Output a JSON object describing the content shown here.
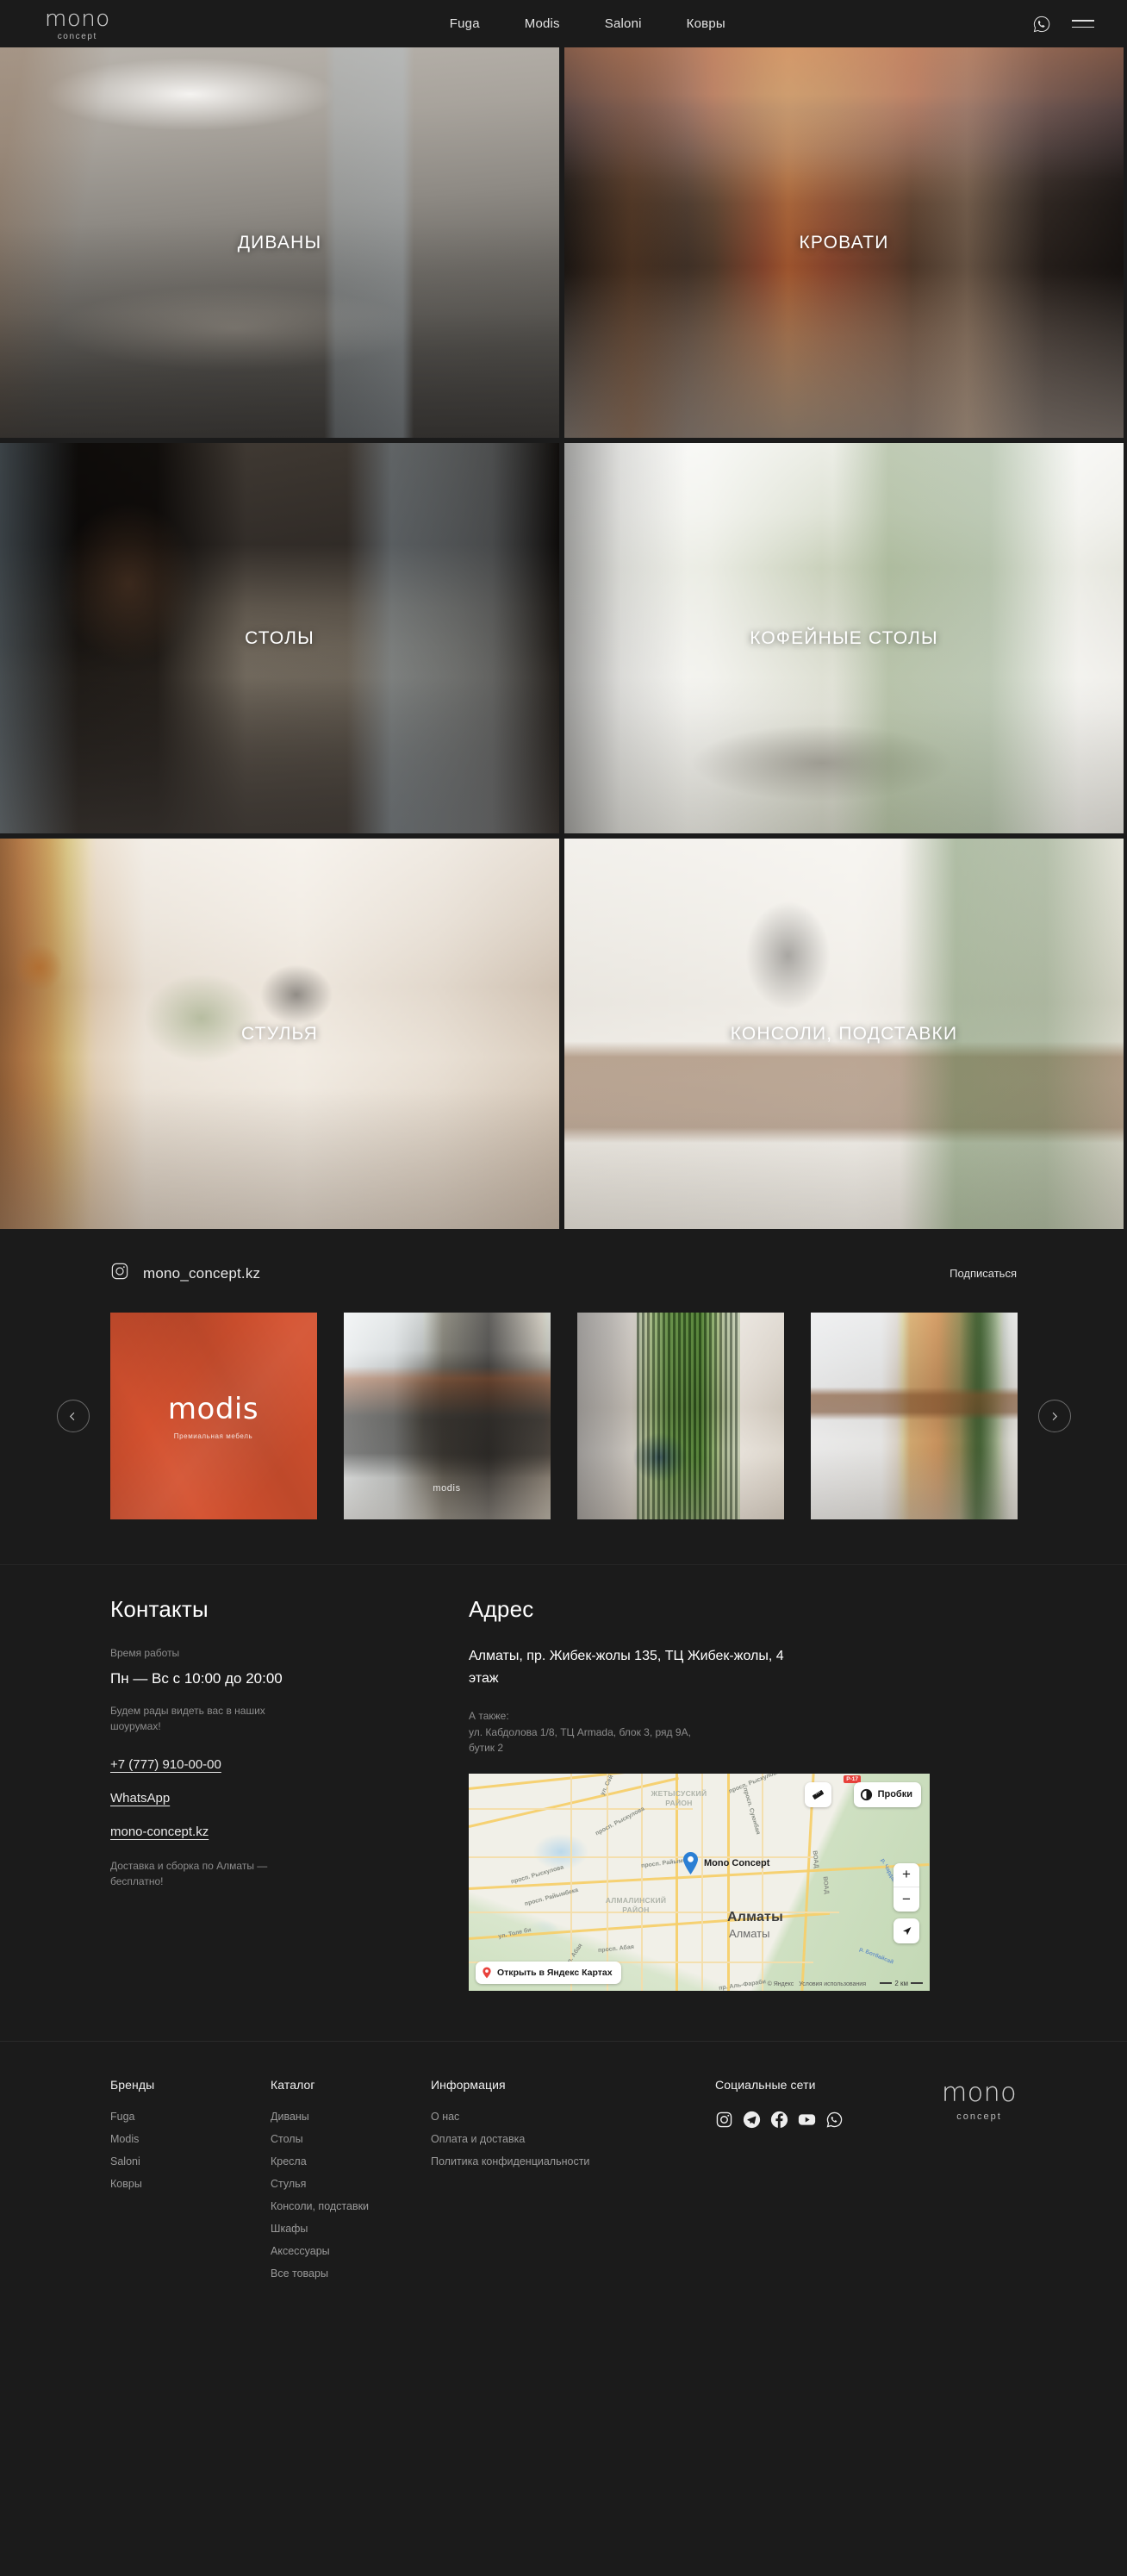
{
  "header": {
    "logo": {
      "main": "mono",
      "sub": "concept"
    },
    "nav": [
      {
        "label": "Fuga"
      },
      {
        "label": "Modis"
      },
      {
        "label": "Saloni"
      },
      {
        "label": "Ковры"
      }
    ],
    "whatsapp_icon": "whatsapp-icon",
    "menu_icon": "hamburger-menu-icon"
  },
  "categories": [
    {
      "label": "ДИВАНЫ"
    },
    {
      "label": "КРОВАТИ"
    },
    {
      "label": "СТОЛЫ"
    },
    {
      "label": "КОФЕЙНЫЕ СТОЛЫ"
    },
    {
      "label": "СТУЛЬЯ"
    },
    {
      "label": "КОНСОЛИ, ПОДСТАВКИ"
    }
  ],
  "instagram": {
    "handle": "mono_concept.kz",
    "subscribe_label": "Подписаться",
    "prev_label": "‹",
    "next_label": "›",
    "cards": [
      {
        "title": "modis",
        "subtitle": "Премиальная мебель",
        "tag": ""
      },
      {
        "title": "",
        "subtitle": "",
        "tag": "modis"
      },
      {
        "title": "",
        "subtitle": "",
        "tag": ""
      },
      {
        "title": "",
        "subtitle": "",
        "tag": ""
      }
    ]
  },
  "contacts": {
    "title": "Контакты",
    "hours_label": "Время работы",
    "hours_value": "Пн — Вс с 10:00 до 20:00",
    "welcome_note": "Будем рады видеть вас в наших шоурумах!",
    "phone": "+7 (777) 910-00-00",
    "whatsapp": "WhatsApp",
    "website": "mono-concept.kz",
    "delivery_note": "Доставка и сборка по Алматы — бесплатно!"
  },
  "address": {
    "title": "Адрес",
    "main": "Алматы, пр. Жибек-жолы 135, ТЦ Жибек-жолы, 4 этаж",
    "also_label": "А также:",
    "also_value": "ул. Кабдолова 1/8, ТЦ Armada, блок 3, ряд 9А, бутик 2"
  },
  "map": {
    "pin_label": "Mono Concept",
    "city": "Алматы",
    "city_alt": "Алматы",
    "districts": [
      {
        "name": "ЖЕТЫСУСКИЙ РАЙОН"
      },
      {
        "name": "АЛМАЛИНСКИЙ РАЙОН"
      }
    ],
    "streets": [
      "просп. Рыскулова",
      "просп. Рыскулова",
      "просп. Рыскулова",
      "просп. Суюнбая",
      "просп. Райымбека",
      "просп. Райымбека",
      "ул. Толе би",
      "просп. Абая",
      "просп. Абая",
      "пр. Аль-Фараби",
      "ул. Сей",
      "ВОАД",
      "ВОАД"
    ],
    "rivers": [
      "р. Чардалы",
      "р. Ботбайсай"
    ],
    "traffic_label": "Пробки",
    "road_badge": "Р-17",
    "zoom_in": "+",
    "zoom_out": "−",
    "open_label": "Открыть в Яндекс Картах",
    "attribution": "© Яндекс",
    "terms": "Условия использования",
    "scale": "2 км"
  },
  "footer": {
    "columns": [
      {
        "head": "Бренды",
        "links": [
          "Fuga",
          "Modis",
          "Saloni",
          "Ковры"
        ]
      },
      {
        "head": "Каталог",
        "links": [
          "Диваны",
          "Столы",
          "Кресла",
          "Стулья",
          "Консоли, подставки",
          "Шкафы",
          "Аксессуары",
          "Все товары"
        ]
      },
      {
        "head": "Информация",
        "links": [
          "О нас",
          "Оплата и доставка",
          "Политика конфиденциальности"
        ]
      }
    ],
    "social_head": "Социальные сети",
    "social": [
      "instagram-icon",
      "telegram-icon",
      "facebook-icon",
      "youtube-icon",
      "whatsapp-icon"
    ],
    "logo": {
      "main": "mono",
      "sub": "concept"
    }
  },
  "colors": {
    "background": "#1b1b1b",
    "text": "#e8e8e8",
    "muted": "#8d8d8d",
    "modis_orange": "#d4512f",
    "map_pin": "#2b7fd4"
  }
}
